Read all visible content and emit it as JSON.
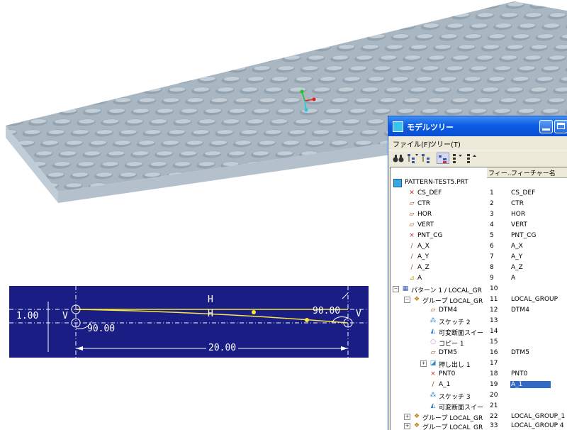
{
  "window": {
    "title": "モデルツリー"
  },
  "menu": {
    "file": "ファイル(F)",
    "tree": "ツリー(T)"
  },
  "columns": {
    "number": "フィー...",
    "feature_name": "フィーチャー名"
  },
  "tree": {
    "root": "PATTERN-TEST5.PRT",
    "rows": [
      {
        "label": "CS_DEF",
        "num": "1",
        "name": "CS_DEF"
      },
      {
        "label": "CTR",
        "num": "2",
        "name": "CTR"
      },
      {
        "label": "HOR",
        "num": "3",
        "name": "HOR"
      },
      {
        "label": "VERT",
        "num": "4",
        "name": "VERT"
      },
      {
        "label": "PNT_CG",
        "num": "5",
        "name": "PNT_CG"
      },
      {
        "label": "A_X",
        "num": "6",
        "name": "A_X"
      },
      {
        "label": "A_Y",
        "num": "7",
        "name": "A_Y"
      },
      {
        "label": "A_Z",
        "num": "8",
        "name": "A_Z"
      },
      {
        "label": "A",
        "num": "9",
        "name": "A"
      },
      {
        "label": "パターン 1 / LOCAL_GR",
        "num": "10",
        "name": ""
      },
      {
        "label": "グループ LOCAL_GR",
        "num": "11",
        "name": "LOCAL_GROUP"
      },
      {
        "label": "DTM4",
        "num": "12",
        "name": "DTM4"
      },
      {
        "label": "スケッチ 2",
        "num": "13",
        "name": ""
      },
      {
        "label": "可変断面スイー",
        "num": "14",
        "name": ""
      },
      {
        "label": "コピー 1",
        "num": "15",
        "name": ""
      },
      {
        "label": "DTM5",
        "num": "16",
        "name": "DTM5"
      },
      {
        "label": "押し出し 1",
        "num": "17",
        "name": ""
      },
      {
        "label": "PNT0",
        "num": "18",
        "name": "PNT0"
      },
      {
        "label": "A_1",
        "num": "19",
        "name": "A_1"
      },
      {
        "label": "スケッチ 3",
        "num": "20",
        "name": ""
      },
      {
        "label": "可変断面スイー",
        "num": "21",
        "name": ""
      },
      {
        "label": "グループ LOCAL_GR",
        "num": "22",
        "name": "LOCAL_GROUP_1"
      },
      {
        "label": "グループ LOCAL_GR",
        "num": "33",
        "name": "LOCAL_GROUP 4"
      }
    ]
  },
  "sketch": {
    "dim_height": "1.00",
    "v_left": "V",
    "angle_left": "90.00",
    "h_upper": "H",
    "h_lower": "H",
    "angle_right": "90.00",
    "v_right": "V",
    "dim_length": "20.00"
  },
  "colors": {
    "sketch_bg": "#1a1d84",
    "plate": "#a9b7c3",
    "selection": "#316ac5",
    "titlebar": "#0a4fd4"
  }
}
